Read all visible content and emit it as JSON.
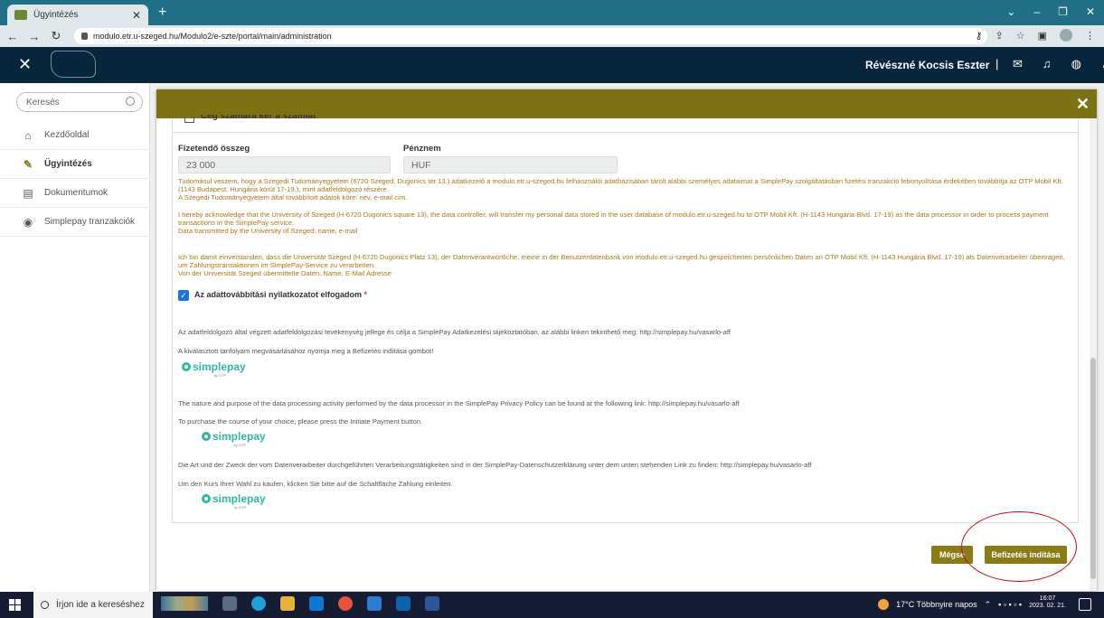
{
  "browser": {
    "tab_title": "Ügyintézés",
    "url": "modulo.etr.u-szeged.hu/Modulo2/e-szte/portal/main/administration"
  },
  "header": {
    "user_name": "Révészné Kocsis Eszter",
    "separator": "|"
  },
  "sidebar": {
    "search_placeholder": "Keresés",
    "items": [
      {
        "label": "Kezdőoldal"
      },
      {
        "label": "Ügyintézés"
      },
      {
        "label": "Dokumentumok"
      },
      {
        "label": "Simplepay tranzakciók"
      }
    ]
  },
  "form": {
    "cutoff_checkbox_label": "Cég számára kér a számlát",
    "amount_label": "Fizetendő összeg",
    "amount_value": "23 000",
    "currency_label": "Pénznem",
    "currency_value": "HUF",
    "consent_hu": "Tudomásul veszem, hogy a Szegedi Tudományegyetem (6720 Szeged, Dugonics tér 13.) adatkezelő a modulo.etr.u-szeged.hu felhasználói adatbázisában tárolt alábbi személyes adataimat a SimplePay szolgáltatásban fizetési tranzakció lebonyolítása érdekében továbbítja az OTP Mobil Kft. (1143 Budapest, Hungária körút 17-19.), mint adatfeldolgozó részére.\nA Szegedi Tudományegyetem által továbbított adatok köre: név, e-mail cím.",
    "consent_en": "I hereby acknowledge that the University of Szeged (H-6720 Dugonics square 13), the data controller, will transfer my personal data stored in the user database of modulo.etr.u-szeged.hu to OTP Mobil Kft. (H-1143 Hungária Blvd. 17-19) as the data processor in order to process payment transactions in the SimplePay service.\nData transmitted by the University of Szeged: name, e-mail",
    "consent_de": "Ich bin damit einverstanden, dass die Universität Szeged (H-6720 Dugonics Platz 13), der Datenverantwortliche, meine in der Benutzerdatenbank von modulo.etr.u-szeged.hu gespeicherten persönlichen Daten an OTP Mobil Kft. (H-1143 Hungária Blvd. 17-19) als Datenverarbeiter übertragen, um Zahlungstransaktionen im SimplePay-Service zu verarbeiten.\nVon der Universität Szeged übermittelte Daten: Name, E-Mail Adresse",
    "accept_label": "Az adattovábbítási nyilatkozatot elfogadom",
    "required_mark": "*",
    "info_hu_1": "Az adatfeldolgozó által végzett adatfeldolgozási tevékenység jellege és célja a SimplePay Adatkezelési tájékoztatóban, az alábbi linken tekinthető meg: http://simplepay.hu/vasarlo-aff",
    "info_hu_2": "A kiválasztott tanfolyam megvásárlásához nyomja meg a Befizetés indítása gombot!",
    "info_en_1": "The nature and purpose of the data processing activity performed by the data processor in the SimplePay Privacy Policy can be found at the following link: http://simplepay.hu/vasarlo-aff",
    "info_en_2": "To purchase the course of your choice, please press the Initiate Payment button.",
    "info_de_1": "Die Art und der Zweck der vom Datenverarbeiter durchgeführten Verarbeitungstätigkeiten sind in der SimplePay-Datenschutzerklärung unter dem unten stehenden Link zu finden: http://simplepay.hu/vasarlo-aff",
    "info_de_2": "Um den Kurs Ihrer Wahl zu kaufen, klicken Sie bitte auf die Schaltfläche Zahlung einleiten.",
    "simplepay_word": "simplepay",
    "simplepay_sub": "by OTP"
  },
  "buttons": {
    "cancel": "Mégse",
    "pay": "Befizetés indítása"
  },
  "taskbar": {
    "search_placeholder": "Írjon ide a kereséshez",
    "weather": "17°C  Többnyire napos",
    "time": "16:07",
    "date": "2023. 02. 21."
  },
  "colors": {
    "accent": "#7d7213",
    "header_bg": "#07263b",
    "text_gold": "#a57c14"
  }
}
